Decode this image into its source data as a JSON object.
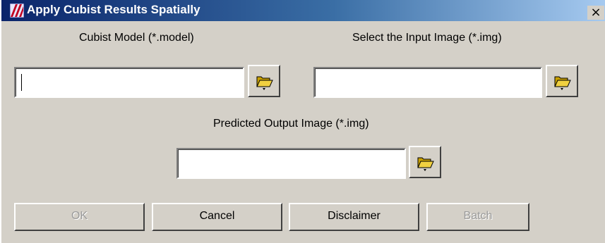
{
  "window": {
    "title": "Apply Cubist Results Spatially",
    "close_symbol": "×",
    "icon": "cubist-app-icon"
  },
  "model_field": {
    "label": "Cubist Model (*.model)",
    "value": "",
    "browse_icon": "open-folder-icon"
  },
  "input_field": {
    "label": "Select the Input Image (*.img)",
    "value": "",
    "browse_icon": "open-folder-icon"
  },
  "output_field": {
    "label": "Predicted Output Image (*.img)",
    "value": "",
    "browse_icon": "open-folder-icon"
  },
  "buttons": {
    "ok": "OK",
    "cancel": "Cancel",
    "disclaimer": "Disclaimer",
    "batch": "Batch"
  },
  "colors": {
    "dialog_bg": "#d4d0c8",
    "titlebar_start": "#0a246a",
    "titlebar_end": "#a6caf0",
    "disabled_text": "#9a9a9a"
  }
}
